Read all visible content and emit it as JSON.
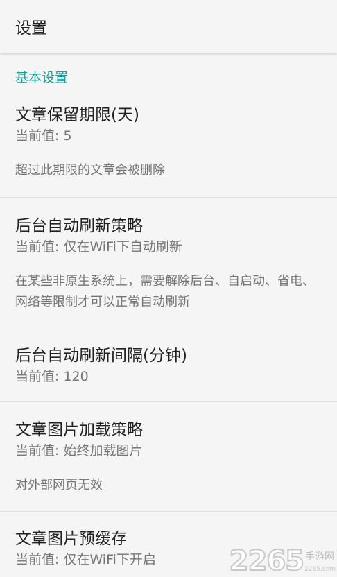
{
  "app_bar": {
    "title": "设置"
  },
  "category": {
    "title": "基本设置"
  },
  "prefs": [
    {
      "title": "文章保留期限(天)",
      "value": "当前值: 5",
      "summary": "超过此期限的文章会被删除"
    },
    {
      "title": "后台自动刷新策略",
      "value": "当前值: 仅在WiFi下自动刷新",
      "summary": "在某些非原生系统上，需要解除后台、自启动、省电、网络等限制才可以正常自动刷新"
    },
    {
      "title": "后台自动刷新间隔(分钟)",
      "value": "当前值: 120"
    },
    {
      "title": "文章图片加载策略",
      "value": "当前值: 始终加载图片",
      "summary": "对外部网页无效"
    },
    {
      "title": "文章图片预缓存",
      "value": "当前值: 仅在WiFi下开启"
    }
  ],
  "watermark": {
    "number": "2265",
    "text": "手游网",
    "site": "2265.com"
  }
}
